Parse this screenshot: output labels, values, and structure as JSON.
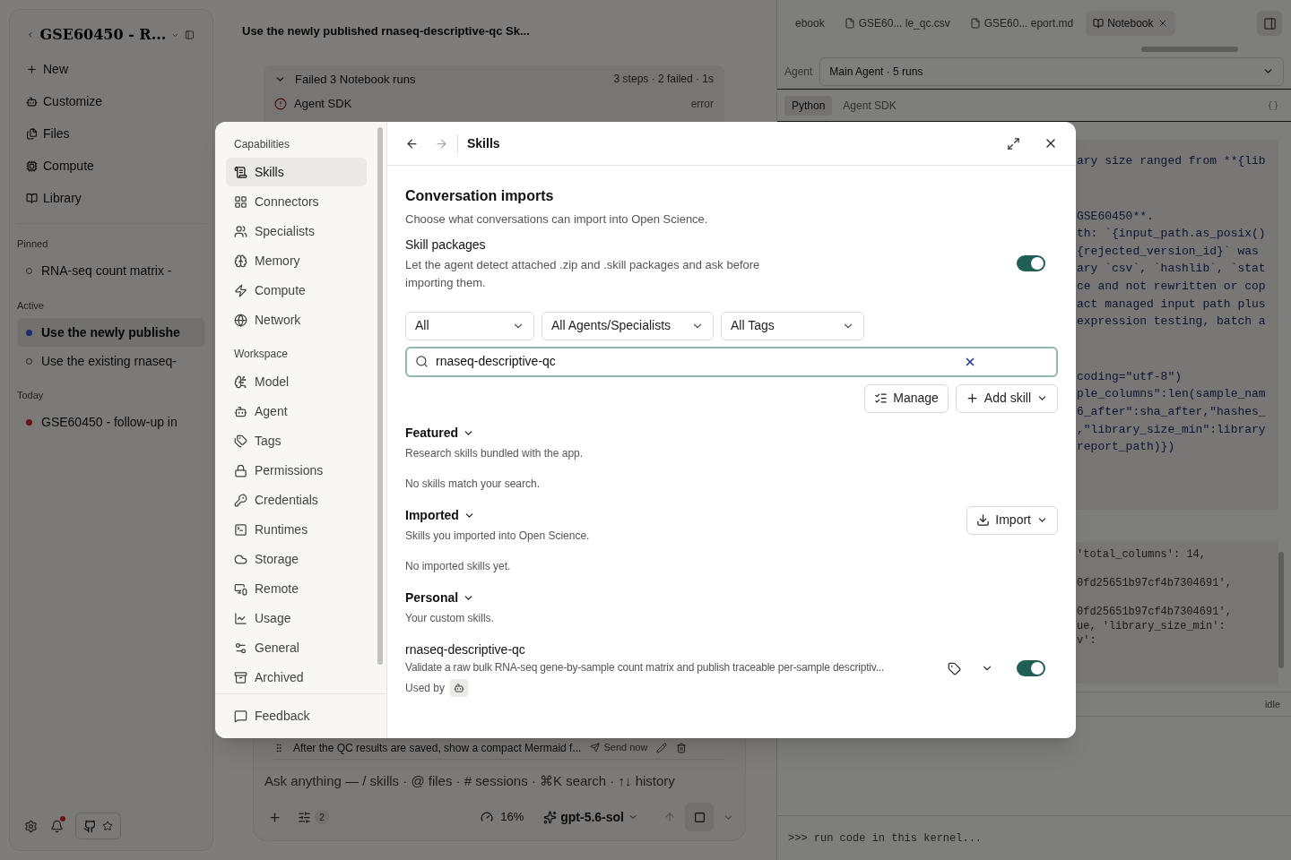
{
  "sidebar": {
    "title": "GSE60450 - R...",
    "nav": [
      "New",
      "Customize",
      "Files",
      "Compute",
      "Library"
    ],
    "sections": [
      {
        "heading": "Pinned",
        "items": [
          {
            "label": "RNA-seq count matrix -",
            "selected": false
          }
        ]
      },
      {
        "heading": "Active",
        "items": [
          {
            "label": "Use the newly publishe",
            "selected": true,
            "color": "#1c2c6e"
          },
          {
            "label": "Use the existing rnaseq-",
            "selected": false
          }
        ]
      },
      {
        "heading": "Today",
        "items": [
          {
            "label": "GSE60450 - follow-up in",
            "selected": false,
            "color": "#6a1410"
          }
        ]
      }
    ],
    "notification_badge": true
  },
  "chat": {
    "title": "Use the newly published rnaseq-descriptive-qc Sk...",
    "runs": {
      "title": "Failed 3 Notebook runs",
      "summary": "3 steps · 2 failed · 1s",
      "rows": [
        {
          "label": "Agent SDK",
          "status": "error"
        }
      ]
    },
    "queued": {
      "text": "After the QC results are saved, show a compact Mermaid f...",
      "send": "Send now"
    },
    "composer": {
      "placeholder": "Ask anything — / skills · @ files · # sessions · ⌘K search · ↑↓ history",
      "tools_count": "2",
      "context": "16%",
      "model": "gpt-5.6-sol"
    }
  },
  "panel": {
    "tabs": [
      {
        "label": "ebook",
        "selected": false
      },
      {
        "label": "GSE60... le_qc.csv",
        "selected": false
      },
      {
        "label": "GSE60... eport.md",
        "selected": false
      },
      {
        "label": "Notebook",
        "selected": true
      }
    ],
    "agent_label": "Agent",
    "agent_value": "Main Agent · 5 runs",
    "kernel_tabs": [
      {
        "label": "Python",
        "selected": true
      },
      {
        "label": "Agent SDK",
        "selected": false
      }
    ],
    "code_groups": [
      [
        "ary size ranged from **{lib"
      ],
      [
        "GSE60450**.",
        "th: `{input_path.as_posix()",
        "{rejected_version_id}` was",
        "ary `csv`, `hashlib`, `stat",
        "ce and not rewritten or cop",
        "act managed input path plus",
        "expression testing, batch a"
      ],
      [
        "coding=\"utf-8\")",
        "ple_columns\":len(sample_nam",
        "6_after\":sha_after,\"hashes_",
        ",\"library_size_min\":library",
        "report_path)})"
      ]
    ],
    "output_groups": [
      [
        "'total_columns': 14,"
      ],
      [
        "0fd25651b97cf4b7304691',"
      ],
      [
        "0fd25651b97cf4b7304691',",
        "ue, 'library_size_min':",
        "v':"
      ]
    ],
    "status": "idle",
    "console_placeholder": ">>> run code in this kernel..."
  },
  "modal": {
    "nav_sections": [
      {
        "heading": "Capabilities",
        "items": [
          {
            "label": "Skills",
            "selected": true
          },
          {
            "label": "Connectors",
            "selected": false
          },
          {
            "label": "Specialists",
            "selected": false
          },
          {
            "label": "Memory",
            "selected": false
          },
          {
            "label": "Compute",
            "selected": false
          },
          {
            "label": "Network",
            "selected": false
          }
        ]
      },
      {
        "heading": "Workspace",
        "items": [
          {
            "label": "Model",
            "selected": false
          },
          {
            "label": "Agent",
            "selected": false
          },
          {
            "label": "Tags",
            "selected": false
          },
          {
            "label": "Permissions",
            "selected": false
          },
          {
            "label": "Credentials",
            "selected": false
          },
          {
            "label": "Runtimes",
            "selected": false
          },
          {
            "label": "Storage",
            "selected": false
          },
          {
            "label": "Remote",
            "selected": false
          },
          {
            "label": "Usage",
            "selected": false
          },
          {
            "label": "General",
            "selected": false
          },
          {
            "label": "Archived",
            "selected": false
          }
        ]
      }
    ],
    "feedback": "Feedback",
    "title": "Skills",
    "heading": "Conversation imports",
    "description": "Choose what conversations can import into Open Science.",
    "packages": {
      "title": "Skill packages",
      "description": "Let the agent detect attached .zip and .skill packages and ask before importing them.",
      "on": true
    },
    "filters": [
      "All",
      "All Agents/Specialists",
      "All Tags"
    ],
    "search": {
      "value": "rnaseq-descriptive-qc"
    },
    "actions": [
      "Manage",
      "Add skill"
    ],
    "groups": [
      {
        "title": "Featured",
        "description": "Research skills bundled with the app.",
        "empty": "No skills match your search."
      },
      {
        "title": "Imported",
        "description": "Skills you imported into Open Science.",
        "empty": "No imported skills yet.",
        "action": "Import"
      },
      {
        "title": "Personal",
        "description": "Your custom skills."
      }
    ],
    "skills": [
      {
        "name": "rnaseq-descriptive-qc",
        "description": "Validate a raw bulk RNA-seq gene-by-sample count matrix and publish traceable per-sample descriptiv...",
        "used_by": "Used by",
        "enabled": true
      }
    ]
  }
}
